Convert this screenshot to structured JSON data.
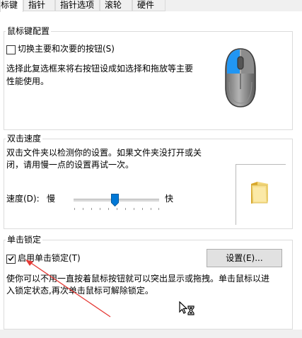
{
  "tabs": [
    {
      "label": "标键"
    },
    {
      "label": "指针"
    },
    {
      "label": "指针选项"
    },
    {
      "label": "滚轮"
    },
    {
      "label": "硬件"
    }
  ],
  "button_config": {
    "title": "鼠标键配置",
    "switch_label": "切换主要和次要的按钮(S)",
    "switch_checked": false,
    "desc_line1": "选择此复选框来将右按钮设成如选择和拖放等主要",
    "desc_line2": "性能使用。",
    "accent_color": "#2196f3"
  },
  "double_click": {
    "title": "双击速度",
    "desc_line1": "双击文件夹以检测你的设置。如果文件夹没打开或关",
    "desc_line2": "闭，请用慢一点的设置再试一次。",
    "speed_label": "速度(D):",
    "slow_label": "慢",
    "fast_label": "快",
    "speed_fraction": 0.5,
    "test_icon": "folder-icon",
    "thumb_color": "#0078d7"
  },
  "click_lock": {
    "title": "单击锁定",
    "enable_label": "启用单击锁定(T)",
    "enable_checked": true,
    "settings_button": "设置(E)...",
    "desc_line1": "使你可以不用一直按着鼠标按钮就可以突出显示或拖拽。单击鼠标以进",
    "desc_line2": "入锁定状态,再次单击鼠标可解除锁定。",
    "cursor_icon": "busy-pointer-icon"
  },
  "annotation": {
    "arrow_color": "#e53935"
  }
}
